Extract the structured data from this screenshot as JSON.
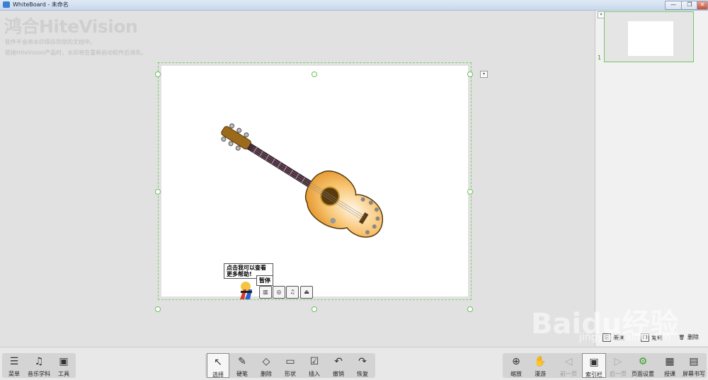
{
  "window": {
    "title": "WhiteBoard - 未命名",
    "minimize": "—",
    "maximize": "❐",
    "close": "✕"
  },
  "watermark": {
    "logo": "鸿合HiteVision",
    "line1": "软件不会将水印保存到您的文档中。",
    "line2": "链接HiteVision产品时，水印将在重新启动软件后消失。"
  },
  "canvas": {
    "tip": "点击我可以查看更多帮助!",
    "pause": "暂停",
    "media_buttons": [
      "▥",
      "◎",
      "♫",
      "⏏"
    ]
  },
  "thumbnails": {
    "page_number": "1"
  },
  "panel_buttons": {
    "new": "新建",
    "copy": "复制",
    "delete": "删除"
  },
  "toolbar": {
    "left": [
      {
        "icon": "☰",
        "label": "菜单"
      },
      {
        "icon": "♫",
        "label": "音乐学科"
      },
      {
        "icon": "▣",
        "label": "工具"
      }
    ],
    "center": [
      {
        "icon": "↖",
        "label": "选择"
      },
      {
        "icon": "✎",
        "label": "硬笔"
      },
      {
        "icon": "◇",
        "label": "删除"
      },
      {
        "icon": "▭",
        "label": "形状"
      },
      {
        "icon": "☑",
        "label": "插入"
      },
      {
        "icon": "↶",
        "label": "撤销"
      },
      {
        "icon": "↷",
        "label": "恢复"
      }
    ],
    "right": [
      {
        "icon": "⊕",
        "label": "缩放"
      },
      {
        "icon": "✋",
        "label": "漫游"
      },
      {
        "icon": "◁",
        "label": "前一页"
      },
      {
        "icon": "▣",
        "label": "索引栏"
      },
      {
        "icon": "▷",
        "label": "后一页"
      },
      {
        "icon": "⚙",
        "label": "页面设置"
      },
      {
        "icon": "▦",
        "label": "授课"
      },
      {
        "icon": "▤",
        "label": "屏幕书写"
      }
    ]
  },
  "site_watermark": {
    "text": "Baidu经验",
    "url": "jingyan.baidu.com"
  }
}
